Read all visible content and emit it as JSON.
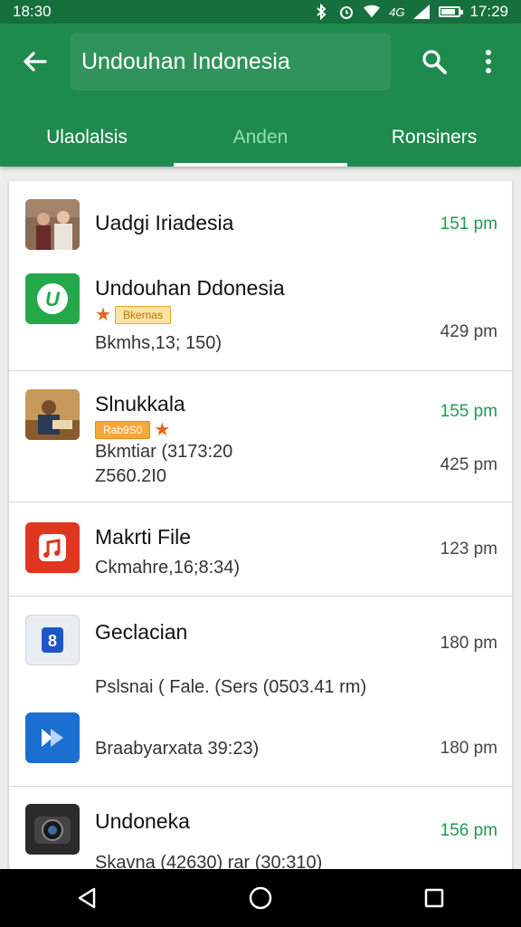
{
  "status_bar": {
    "time_left": "18:30",
    "time_right": "17:29",
    "network_label": "4G"
  },
  "app_bar": {
    "search_value": "Undouhan Indonesia"
  },
  "tabs": [
    {
      "label": "Ulaolalsis",
      "active": false
    },
    {
      "label": "Anden",
      "active": true
    },
    {
      "label": "Ronsiners",
      "active": false
    }
  ],
  "rows": [
    {
      "title": "Uadgi Iriadesia",
      "time": "151 pm"
    },
    {
      "title": "Undouhan Ddonesia",
      "badge": "Bkernas",
      "subtitle": "Bkmhs,13; 150)",
      "time": "429 pm"
    },
    {
      "title": "Slnukkala",
      "badge": "Rab9S0",
      "subtitle": "Bkmtiar (3173:20",
      "subtitle2": "Z560.2I0",
      "time": "155 pm",
      "time2": "425 pm"
    },
    {
      "title": "Makrti File",
      "subtitle": "Ckmahre,16;8:34)",
      "time": "123 pm"
    },
    {
      "title": "Geclacian",
      "subtitle": "Pslsnai ( Fale. (Sers (0503.41 rm)",
      "subtitle2": "Braabyarxata 39:23)",
      "time": "180 pm",
      "time2": "180 pm"
    },
    {
      "title": "Undoneka",
      "subtitle": "Skavna (42630) rar (30:310)",
      "time": "156 pm"
    }
  ]
}
